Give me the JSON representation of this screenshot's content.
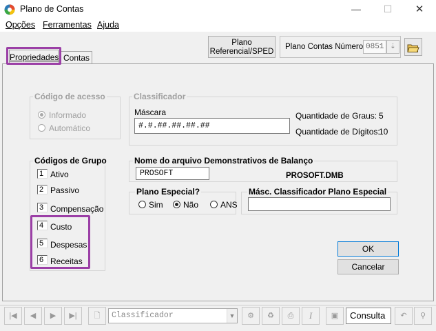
{
  "window": {
    "title": "Plano de Contas",
    "minimize_glyph": "—",
    "maximize_glyph": "☐",
    "close_glyph": "✕"
  },
  "menu": [
    {
      "label": "Opções",
      "key": "O"
    },
    {
      "label": "Ferramentas",
      "key": "F"
    },
    {
      "label": "Ajuda",
      "key": "A"
    }
  ],
  "tabs": [
    {
      "label": "Propriedades"
    },
    {
      "label": "Contas"
    }
  ],
  "toolbar": {
    "plano_ref_line1": "Plano",
    "plano_ref_line2": "Referencial/SPED",
    "numero_label": "Plano Contas Número",
    "numero_value": "0851"
  },
  "codigo_acesso": {
    "title": "Código de acesso",
    "options": [
      {
        "label": "Informado",
        "selected": true
      },
      {
        "label": "Automático",
        "selected": false
      }
    ]
  },
  "classificador": {
    "title": "Classificador",
    "mascara_label": "Máscara",
    "mascara_value": "#.#.##.##.##.##",
    "graus_label": "Quantidade de Graus:",
    "graus_value": "5",
    "digitos_label": "Quantidade de Dígitos:",
    "digitos_value": "10"
  },
  "codigos_grupo": {
    "title": "Códigos de Grupo",
    "items": [
      {
        "num": "1",
        "label": "Ativo"
      },
      {
        "num": "2",
        "label": "Passivo"
      },
      {
        "num": "3",
        "label": "Compensação"
      },
      {
        "num": "4",
        "label": "Custo"
      },
      {
        "num": "5",
        "label": "Despesas"
      },
      {
        "num": "6",
        "label": "Receitas"
      }
    ]
  },
  "demonstrativos": {
    "title": "Nome do arquivo Demonstrativos de Balanço",
    "input_value": "PROSOFT",
    "file_name": "PROSOFT.DMB"
  },
  "plano_especial": {
    "title": "Plano Especial?",
    "options": [
      {
        "label": "Sim",
        "selected": false
      },
      {
        "label": "Não",
        "selected": true
      },
      {
        "label": "ANS",
        "selected": false
      }
    ]
  },
  "masc_especial": {
    "title": "Másc. Classificador Plano Especial",
    "value": ""
  },
  "actions": {
    "ok": "OK",
    "cancelar": "Cancelar"
  },
  "navbar": {
    "combo_value": "Classificador",
    "mode": "Consulta",
    "icons": [
      "first-icon",
      "prev-icon",
      "next-icon",
      "last-icon",
      "new-doc-icon",
      "filter-icon",
      "recycle-icon",
      "print-icon",
      "italic-icon",
      "save-icon",
      "undo-icon",
      "binoculars-icon"
    ]
  },
  "colors": {
    "highlight": "#9b3fa6"
  }
}
